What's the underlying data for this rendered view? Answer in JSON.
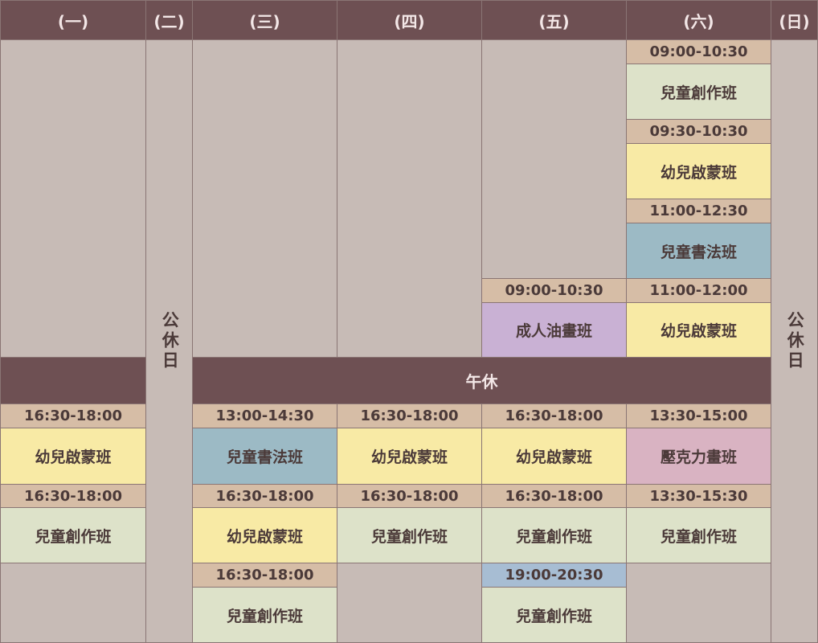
{
  "headers": {
    "mon": "(一)",
    "tue": "(二)",
    "wed": "(三)",
    "thu": "(四)",
    "fri": "(五)",
    "sat": "(六)",
    "sun": "(日)"
  },
  "closed_label": "公休日",
  "lunch_label": "午休",
  "morning": {
    "fri": [
      {
        "time": "09:00-10:30",
        "name": "成人油畫班"
      }
    ],
    "sat": [
      {
        "time": "09:00-10:30",
        "name": "兒童創作班"
      },
      {
        "time": "09:30-10:30",
        "name": "幼兒啟蒙班"
      },
      {
        "time": "11:00-12:30",
        "name": "兒童書法班"
      },
      {
        "time": "11:00-12:00",
        "name": "幼兒啟蒙班"
      }
    ]
  },
  "afternoon": {
    "mon": [
      {
        "time": "16:30-18:00",
        "name": "幼兒啟蒙班"
      },
      {
        "time": "16:30-18:00",
        "name": "兒童創作班"
      }
    ],
    "wed": [
      {
        "time": "13:00-14:30",
        "name": "兒童書法班"
      },
      {
        "time": "16:30-18:00",
        "name": "幼兒啟蒙班"
      },
      {
        "time": "16:30-18:00",
        "name": "兒童創作班"
      }
    ],
    "thu": [
      {
        "time": "16:30-18:00",
        "name": "幼兒啟蒙班"
      },
      {
        "time": "16:30-18:00",
        "name": "兒童創作班"
      }
    ],
    "fri": [
      {
        "time": "16:30-18:00",
        "name": "幼兒啟蒙班"
      },
      {
        "time": "16:30-18:00",
        "name": "兒童創作班"
      },
      {
        "time": "19:00-20:30",
        "name": "兒童創作班"
      }
    ],
    "sat": [
      {
        "time": "13:30-15:00",
        "name": "壓克力畫班"
      },
      {
        "time": "13:30-15:30",
        "name": "兒童創作班"
      }
    ]
  },
  "colors": {
    "header": "#6e5053",
    "empty": "#c7bbb6",
    "time": "#d6bda6",
    "time_evening": "#a7bdd3",
    "class_green": "#dde2c9",
    "class_yellow": "#f8eaa5",
    "class_blue": "#9cbac5",
    "class_purple": "#c9b1d4",
    "class_pink": "#d9b3c2"
  }
}
